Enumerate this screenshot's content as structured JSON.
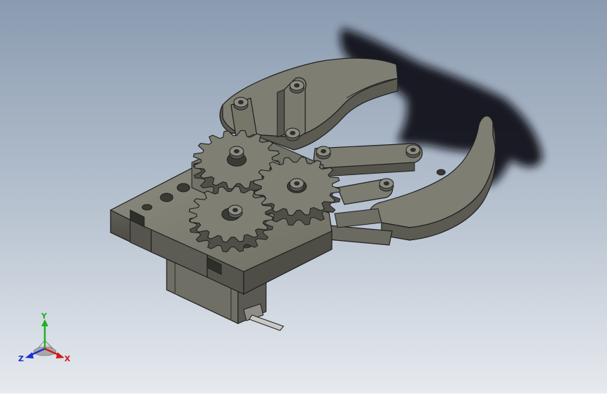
{
  "viewport": {
    "background_top": "#8a9bb0",
    "background_bottom": "#e6eaef",
    "part_color": "#75756a",
    "edge_color": "#1e1e1e",
    "shadow_color": "#0d0d10"
  },
  "triad": {
    "x_label": "X",
    "y_label": "Y",
    "z_label": "Z",
    "x_color": "#d11a1a",
    "y_color": "#20b020",
    "z_color": "#1c2fd4"
  }
}
